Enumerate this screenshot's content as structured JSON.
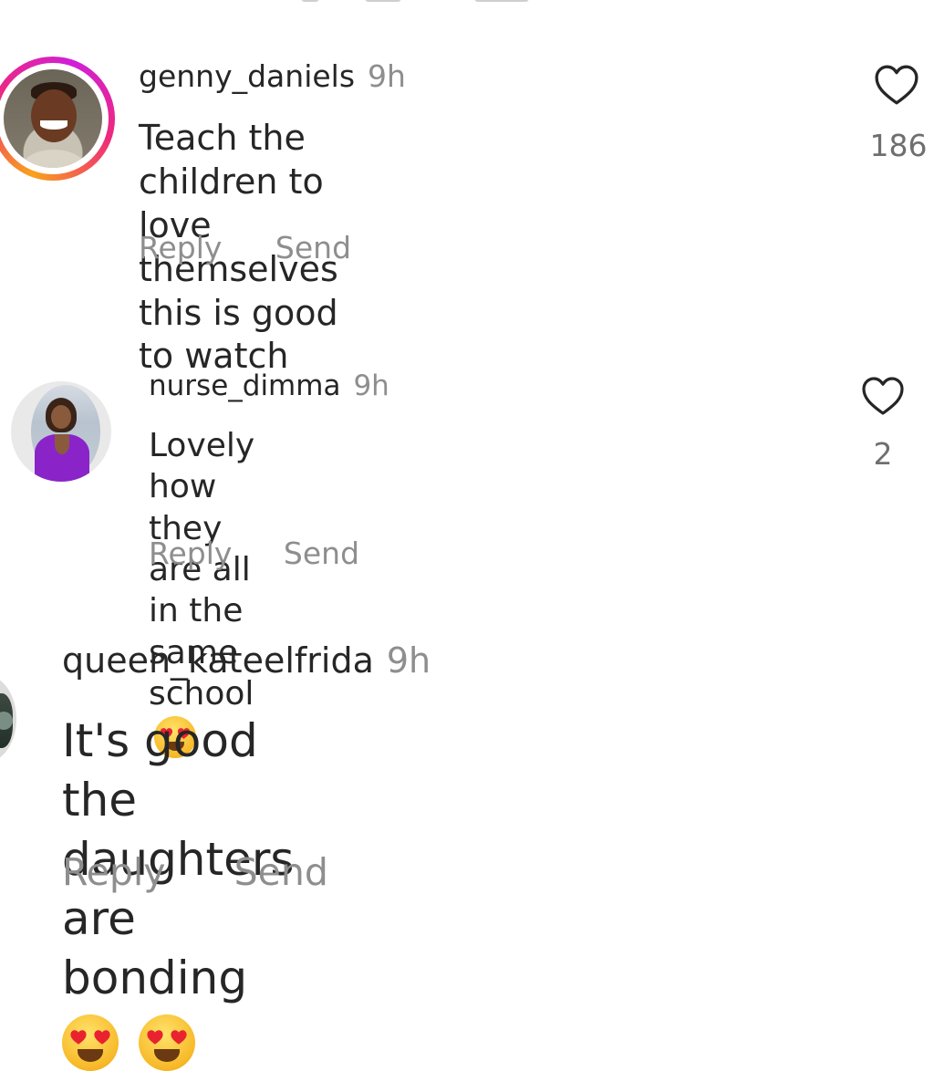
{
  "comments": [
    {
      "username": "genny_daniels",
      "time": "9h",
      "text_line1": "Teach the children to love themselves",
      "text_line2": "this is good to watch",
      "likes": "186",
      "reply_label": "Reply",
      "send_label": "Send",
      "has_story": true
    },
    {
      "username": "nurse_dimma",
      "time": "9h",
      "text_line1": "Lovely how they are all in the same",
      "text_line2": "school",
      "emoji": "😍",
      "likes": "2",
      "reply_label": "Reply",
      "send_label": "Send",
      "has_story": false
    },
    {
      "username": "queen_kateelfrida",
      "time": "9h",
      "text_line1": "It's good the daughters are bonding",
      "emoji_count": 2,
      "reply_label": "Reply",
      "send_label": "Send",
      "has_story": false
    }
  ],
  "icons": {
    "like": "heart-outline-icon",
    "emoji": "smiling-face-with-heart-eyes"
  },
  "colors": {
    "text": "#262626",
    "muted": "#8e8e8e",
    "story_ring": [
      "#f9a11b",
      "#ee2a7b",
      "#d01fd8"
    ],
    "heart_stroke": "#262626"
  }
}
